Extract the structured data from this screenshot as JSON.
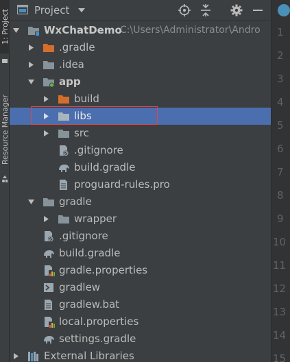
{
  "tool_strip": {
    "project_tab": "1: Project",
    "resource_tab": "Resource Manager"
  },
  "header": {
    "title": "Project"
  },
  "tree": {
    "root": {
      "name": "WxChatDemo",
      "path": "C:\\Users\\Administrator\\Andro"
    },
    "gradle_dir": ".gradle",
    "idea_dir": ".idea",
    "app_dir": "app",
    "app_build": "build",
    "app_libs": "libs",
    "app_src": "src",
    "app_gitignore": ".gitignore",
    "app_build_gradle": "build.gradle",
    "app_proguard": "proguard-rules.pro",
    "gradle_folder": "gradle",
    "wrapper": "wrapper",
    "gitignore": ".gitignore",
    "build_gradle": "build.gradle",
    "gradle_properties": "gradle.properties",
    "gradlew": "gradlew",
    "gradlew_bat": "gradlew.bat",
    "local_properties": "local.properties",
    "settings_gradle": "settings.gradle",
    "external_libraries": "External Libraries"
  },
  "editor": {
    "line_numbers": [
      "1",
      "2",
      "3",
      "4",
      "5",
      "6",
      "7",
      "8",
      "9",
      "10",
      "11",
      "12",
      "13",
      "14",
      "15"
    ]
  },
  "colors": {
    "background": "#3c3f41",
    "selection": "#4b6eaf",
    "highlight_box": "#e0454a",
    "folder": "#87939a",
    "excluded_folder": "#d46e2d"
  }
}
